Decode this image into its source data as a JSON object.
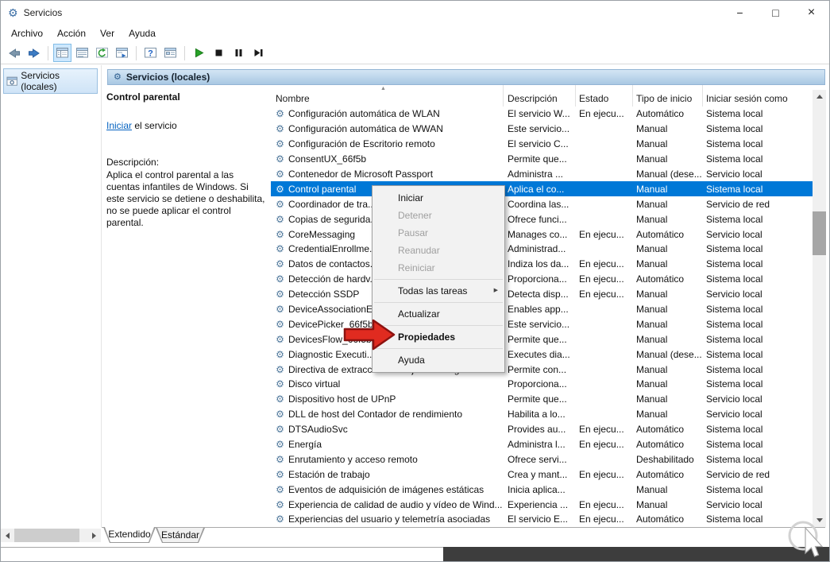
{
  "window": {
    "title": "Servicios",
    "controls": {
      "minimize": "−",
      "maximize": "□",
      "close": "×"
    }
  },
  "menubar": {
    "items": [
      "Archivo",
      "Acción",
      "Ver",
      "Ayuda"
    ]
  },
  "toolbar": {
    "icons": [
      "back-icon",
      "forward-icon",
      "console-tree-icon",
      "action-pane-icon",
      "refresh-icon",
      "export-list-icon",
      "help-icon",
      "properties-icon",
      "play-icon",
      "stop-icon",
      "pause-icon",
      "restart-icon"
    ]
  },
  "tree": {
    "root_label": "Servicios (locales)"
  },
  "content": {
    "header": "Servicios (locales)",
    "side_panel": {
      "service_name": "Control parental",
      "start_link": "Iniciar",
      "start_suffix": " el servicio",
      "description_label": "Descripción:",
      "description_text": "Aplica el control parental a las cuentas infantiles de Windows. Si este servicio se detiene o deshabilita, no se puede aplicar el control parental."
    },
    "table": {
      "columns": [
        "Nombre",
        "Descripción",
        "Estado",
        "Tipo de inicio",
        "Iniciar sesión como"
      ],
      "rows": [
        {
          "name": "Configuración automática de WLAN",
          "description": "El servicio W...",
          "estado": "En ejecu...",
          "tipo": "Automático",
          "sesion": "Sistema local"
        },
        {
          "name": "Configuración automática de WWAN",
          "description": "Este servicio...",
          "estado": "",
          "tipo": "Manual",
          "sesion": "Sistema local"
        },
        {
          "name": "Configuración de Escritorio remoto",
          "description": "El servicio C...",
          "estado": "",
          "tipo": "Manual",
          "sesion": "Sistema local"
        },
        {
          "name": "ConsentUX_66f5b",
          "description": "Permite que...",
          "estado": "",
          "tipo": "Manual",
          "sesion": "Sistema local"
        },
        {
          "name": "Contenedor de Microsoft Passport",
          "description": "Administra ...",
          "estado": "",
          "tipo": "Manual (dese...",
          "sesion": "Servicio local"
        },
        {
          "name": "Control parental",
          "description": "Aplica el co...",
          "estado": "",
          "tipo": "Manual",
          "sesion": "Sistema local",
          "selected": true
        },
        {
          "name": "Coordinador de tra...",
          "description": "Coordina las...",
          "estado": "",
          "tipo": "Manual",
          "sesion": "Servicio de red"
        },
        {
          "name": "Copias de segurida...",
          "description": "Ofrece funci...",
          "estado": "",
          "tipo": "Manual",
          "sesion": "Sistema local"
        },
        {
          "name": "CoreMessaging",
          "description": "Manages co...",
          "estado": "En ejecu...",
          "tipo": "Automático",
          "sesion": "Servicio local"
        },
        {
          "name": "CredentialEnrollme...",
          "description": "Administrad...",
          "estado": "",
          "tipo": "Manual",
          "sesion": "Sistema local"
        },
        {
          "name": "Datos de contactos...",
          "description": "Indiza los da...",
          "estado": "En ejecu...",
          "tipo": "Manual",
          "sesion": "Sistema local"
        },
        {
          "name": "Detección de hardv...",
          "description": "Proporciona...",
          "estado": "En ejecu...",
          "tipo": "Automático",
          "sesion": "Sistema local"
        },
        {
          "name": "Detección SSDP",
          "description": "Detecta disp...",
          "estado": "En ejecu...",
          "tipo": "Manual",
          "sesion": "Servicio local"
        },
        {
          "name": "DeviceAssociationE...",
          "description": "Enables app...",
          "estado": "",
          "tipo": "Manual",
          "sesion": "Sistema local"
        },
        {
          "name": "DevicePicker_66f5b",
          "description": "Este servicio...",
          "estado": "",
          "tipo": "Manual",
          "sesion": "Sistema local"
        },
        {
          "name": "DevicesFlow_66f5b",
          "description": "Permite que...",
          "estado": "",
          "tipo": "Manual",
          "sesion": "Sistema local"
        },
        {
          "name": "Diagnostic Executi...",
          "description": "Executes dia...",
          "estado": "",
          "tipo": "Manual (dese...",
          "sesion": "Sistema local"
        },
        {
          "name": "Directiva de extracción de tarjetas inteligentes",
          "description": "Permite con...",
          "estado": "",
          "tipo": "Manual",
          "sesion": "Sistema local"
        },
        {
          "name": "Disco virtual",
          "description": "Proporciona...",
          "estado": "",
          "tipo": "Manual",
          "sesion": "Sistema local"
        },
        {
          "name": "Dispositivo host de UPnP",
          "description": "Permite que...",
          "estado": "",
          "tipo": "Manual",
          "sesion": "Servicio local"
        },
        {
          "name": "DLL de host del Contador de rendimiento",
          "description": "Habilita a lo...",
          "estado": "",
          "tipo": "Manual",
          "sesion": "Servicio local"
        },
        {
          "name": "DTSAudioSvc",
          "description": "Provides au...",
          "estado": "En ejecu...",
          "tipo": "Automático",
          "sesion": "Sistema local"
        },
        {
          "name": "Energía",
          "description": "Administra l...",
          "estado": "En ejecu...",
          "tipo": "Automático",
          "sesion": "Sistema local"
        },
        {
          "name": "Enrutamiento y acceso remoto",
          "description": "Ofrece servi...",
          "estado": "",
          "tipo": "Deshabilitado",
          "sesion": "Sistema local"
        },
        {
          "name": "Estación de trabajo",
          "description": "Crea y mant...",
          "estado": "En ejecu...",
          "tipo": "Automático",
          "sesion": "Servicio de red"
        },
        {
          "name": "Eventos de adquisición de imágenes estáticas",
          "description": "Inicia aplica...",
          "estado": "",
          "tipo": "Manual",
          "sesion": "Sistema local"
        },
        {
          "name": "Experiencia de calidad de audio y vídeo de Wind...",
          "description": "Experiencia ...",
          "estado": "En ejecu...",
          "tipo": "Manual",
          "sesion": "Servicio local"
        },
        {
          "name": "Experiencias del usuario y telemetría asociadas",
          "description": "El servicio E...",
          "estado": "En ejecu...",
          "tipo": "Automático",
          "sesion": "Sistema local"
        }
      ]
    },
    "tabs": [
      {
        "label": "Extendido",
        "selected": true
      },
      {
        "label": "Estándar",
        "selected": false
      }
    ]
  },
  "context_menu": {
    "items": [
      {
        "type": "item",
        "label": "Iniciar",
        "enabled": true
      },
      {
        "type": "item",
        "label": "Detener",
        "enabled": false
      },
      {
        "type": "item",
        "label": "Pausar",
        "enabled": false
      },
      {
        "type": "item",
        "label": "Reanudar",
        "enabled": false
      },
      {
        "type": "item",
        "label": "Reiniciar",
        "enabled": false
      },
      {
        "type": "separator"
      },
      {
        "type": "item",
        "label": "Todas las tareas",
        "enabled": true,
        "submenu": true
      },
      {
        "type": "separator"
      },
      {
        "type": "item",
        "label": "Actualizar",
        "enabled": true
      },
      {
        "type": "separator"
      },
      {
        "type": "item",
        "label": "Propiedades",
        "enabled": true,
        "default": true
      },
      {
        "type": "separator"
      },
      {
        "type": "item",
        "label": "Ayuda",
        "enabled": true
      }
    ]
  },
  "icons": {
    "app": "⚙",
    "service_gear": "⚙",
    "submenu_arrow": "▶",
    "sort_ascending": "▲"
  },
  "colors": {
    "selection": "#0078d7",
    "link": "#0563c1",
    "header_bar": "#b9d3ea",
    "annotation_arrow": "#e02b20",
    "dark_strip": "#3d3d3d"
  }
}
